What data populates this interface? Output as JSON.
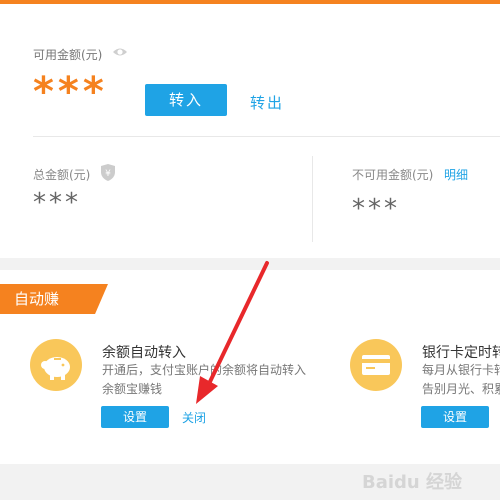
{
  "balance": {
    "available_label": "可用金额(元)",
    "available_value": "***",
    "transfer_in": "转入",
    "transfer_out": "转出",
    "total_label": "总金额(元)",
    "total_value": "***",
    "unavailable_label": "不可用金额(元)",
    "detail_link": "明细",
    "unavailable_value": "***"
  },
  "auto_earn": {
    "ribbon": "自动赚",
    "items": [
      {
        "title": "余额自动转入",
        "desc_line1": "开通后，支付宝账户的余额将自动转入",
        "desc_line2": "余额宝赚钱",
        "button": "设置",
        "close": "关闭",
        "icon": "piggy-bank-icon"
      },
      {
        "title": "银行卡定时转",
        "desc_line1": "每月从银行卡转",
        "desc_line2": "告别月光、积累",
        "button": "设置",
        "icon": "bank-card-icon"
      }
    ]
  },
  "watermark": "Baidu 经验",
  "colors": {
    "accent": "#f5821f",
    "link": "#1fa3e5",
    "icon_bg": "#f9c75a",
    "annotation": "#e8282b"
  }
}
